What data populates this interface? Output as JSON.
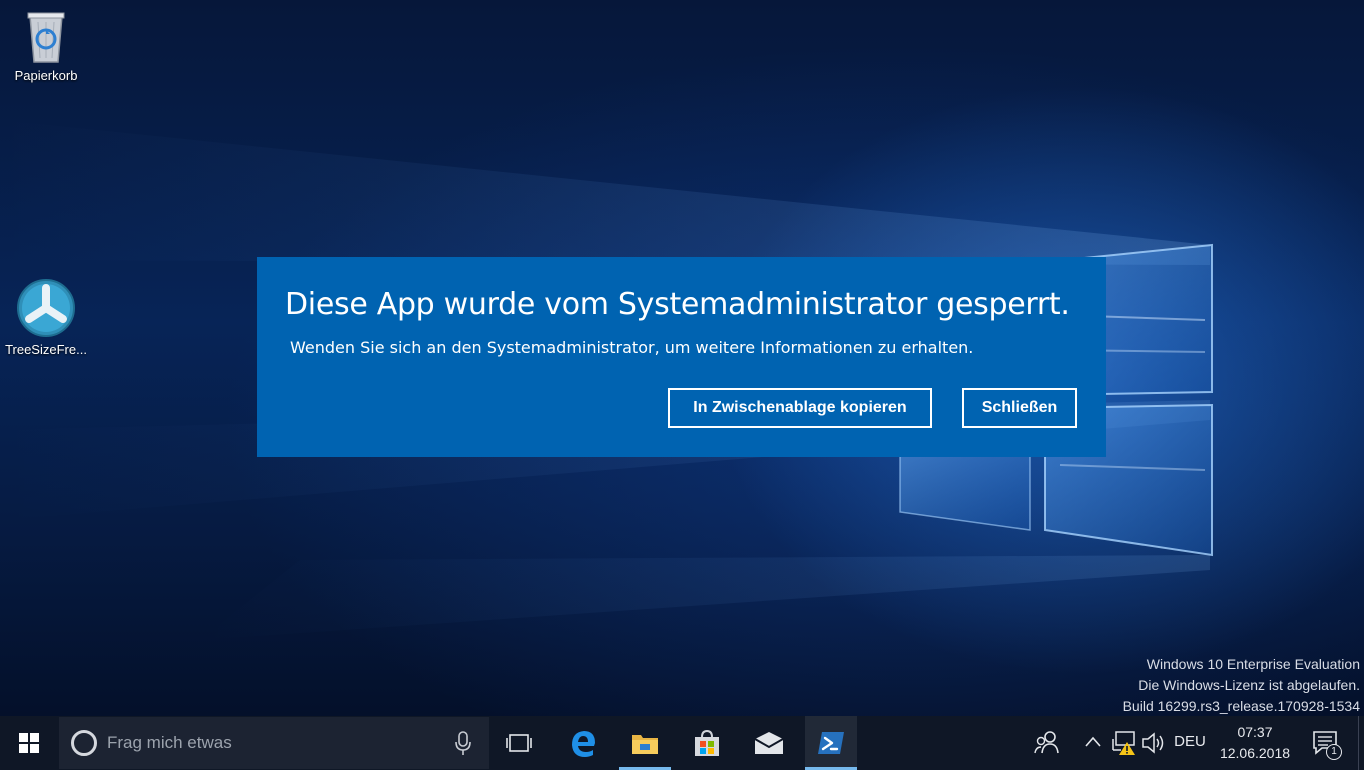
{
  "desktop": {
    "icons": [
      {
        "label": "Papierkorb",
        "icon": "recycle-bin-icon"
      },
      {
        "label": "TreeSizeFre...",
        "icon": "treesize-icon"
      }
    ]
  },
  "dialog": {
    "title": "Diese App wurde vom Systemadministrator gesperrt.",
    "message": "Wenden Sie sich an den Systemadministrator, um weitere Informationen zu erhalten.",
    "copy_button_label": "In Zwischenablage kopieren",
    "close_button_label": "Schließen",
    "background_color": "#0063b1"
  },
  "watermark": {
    "line1": "Windows 10 Enterprise Evaluation",
    "line2": "Die Windows-Lizenz ist abgelaufen.",
    "line3": "Build 16299.rs3_release.170928-1534"
  },
  "taskbar": {
    "search_placeholder": "Frag mich etwas",
    "apps": [
      {
        "name": "task-view-icon"
      },
      {
        "name": "edge-icon"
      },
      {
        "name": "file-explorer-icon"
      },
      {
        "name": "store-icon"
      },
      {
        "name": "mail-icon"
      },
      {
        "name": "powershell-icon"
      }
    ],
    "tray": {
      "language": "DEU",
      "time": "07:37",
      "date": "12.06.2018",
      "notification_count": "1"
    },
    "accent_color": "#76b9ed"
  }
}
